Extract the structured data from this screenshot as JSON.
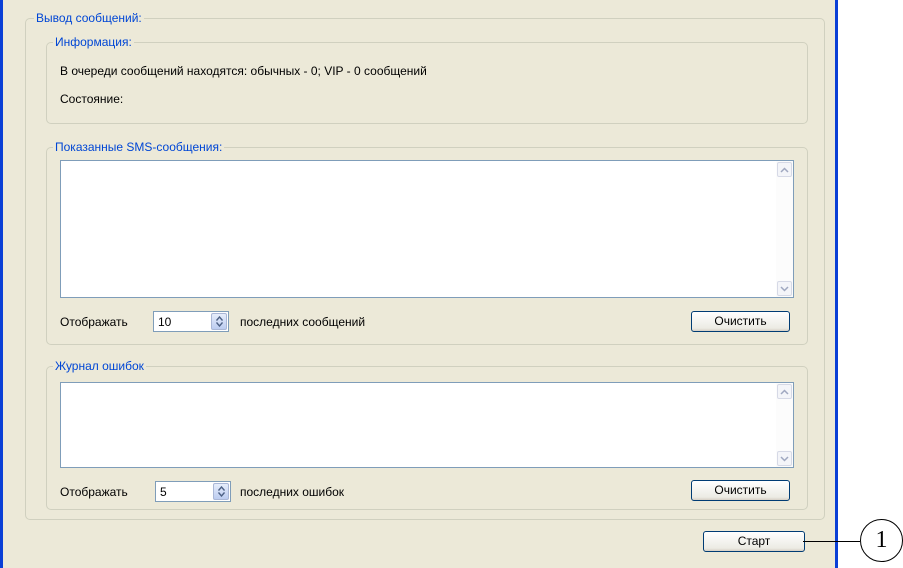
{
  "output_group": {
    "legend": "Вывод сообщений:",
    "info_group": {
      "legend": "Информация:",
      "queue_text": "В очереди сообщений находятся: обычных - 0; VIP - 0 сообщений",
      "state_label": "Состояние:"
    },
    "sms_group": {
      "legend": "Показанные SMS-сообщения:",
      "show_label": "Отображать",
      "count_value": "10",
      "suffix_label": "последних сообщений",
      "clear_button": "Очистить"
    },
    "errors_group": {
      "legend": "Журнал ошибок",
      "show_label": "Отображать",
      "count_value": "5",
      "suffix_label": "последних ошибок",
      "clear_button": "Очистить"
    }
  },
  "start_button": "Старт",
  "callout": "1",
  "colors": {
    "window_bg": "#ece9d8",
    "frame_blue": "#0a3fd6",
    "legend_blue": "#0046d5"
  }
}
